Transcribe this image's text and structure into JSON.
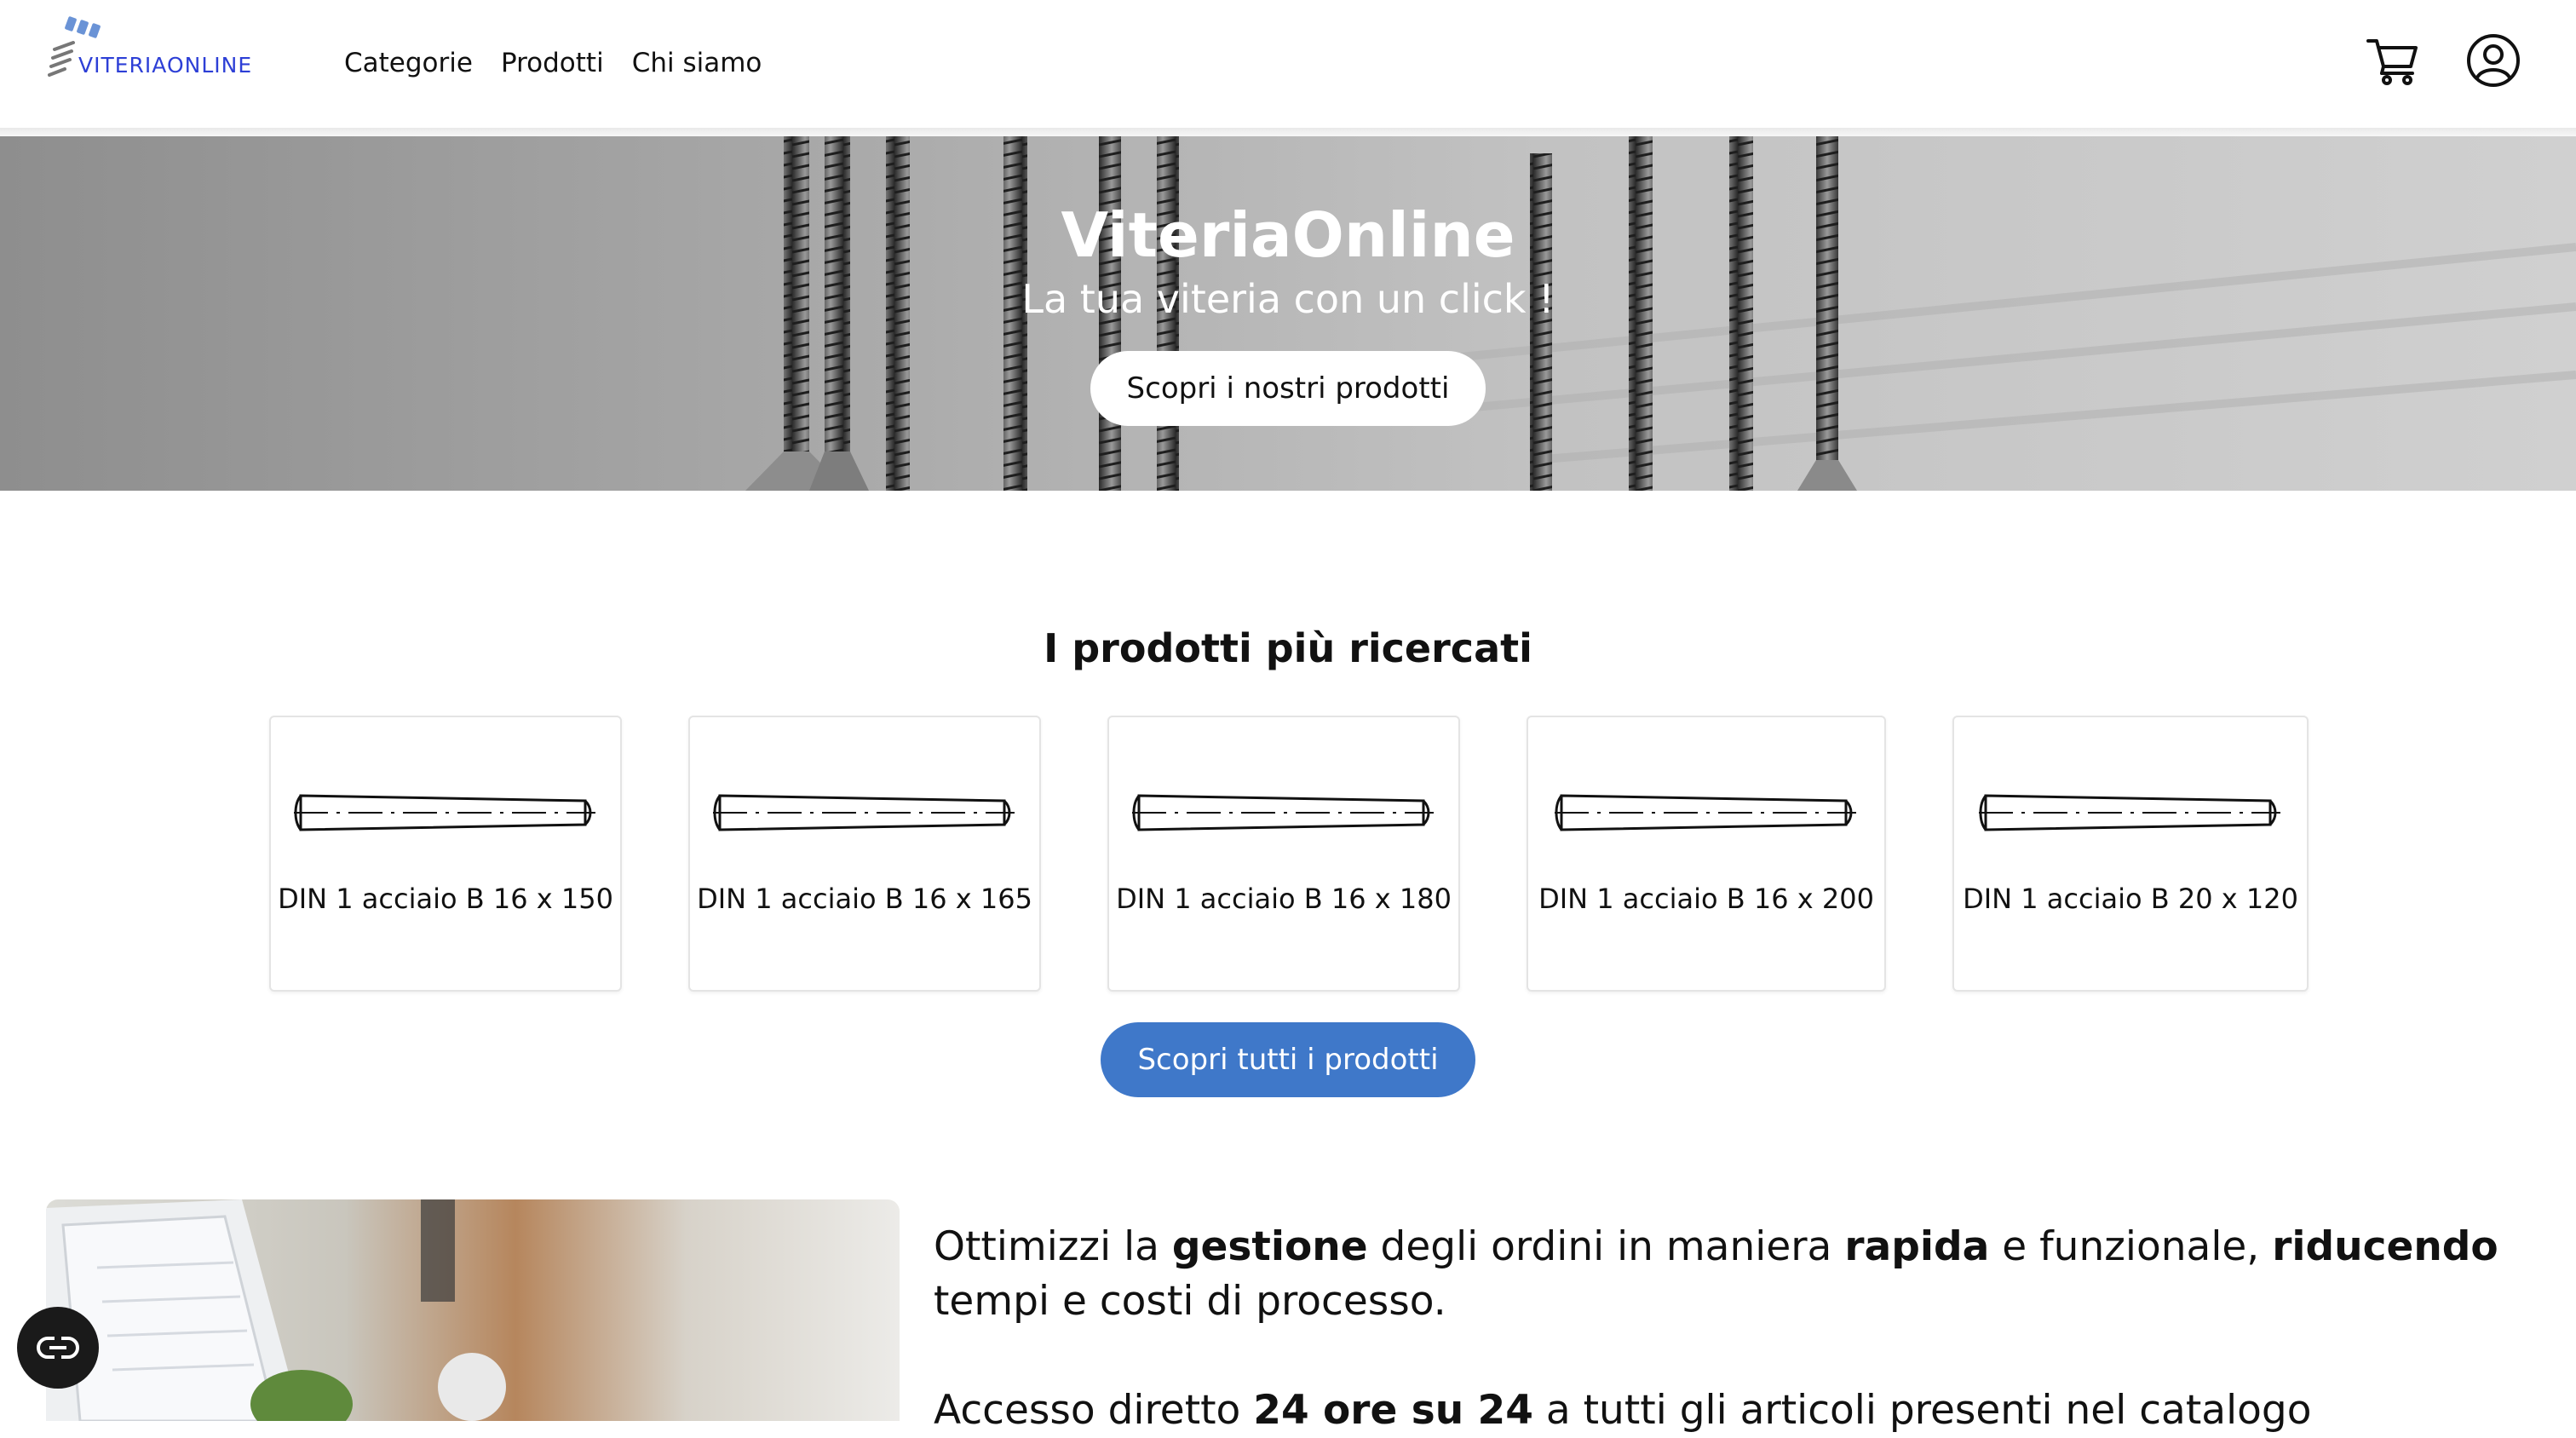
{
  "header": {
    "logo_text": "VITERIAONLINE",
    "nav": [
      "Categorie",
      "Prodotti",
      "Chi siamo"
    ],
    "cart_icon": "cart-icon",
    "user_icon": "user-circle-icon"
  },
  "hero": {
    "title": "ViteriaOnline",
    "subtitle": "La tua viteria con un click !",
    "cta": "Scopri i nostri prodotti"
  },
  "products": {
    "title": "I prodotti più ricercati",
    "items": [
      {
        "name": "DIN 1 acciaio B 16 x 150"
      },
      {
        "name": "DIN 1 acciaio B 16 x 165"
      },
      {
        "name": "DIN 1 acciaio B 16 x 180"
      },
      {
        "name": "DIN 1 acciaio B 16 x 200"
      },
      {
        "name": "DIN 1 acciaio B 20 x 120"
      }
    ],
    "cta": "Scopri tutti i prodotti"
  },
  "info": {
    "p1": [
      "Ottimizzi la ",
      "gestione",
      " degli ordini in maniera ",
      "rapida",
      " e funzionale, ",
      "riducendo",
      " tempi e costi di processo."
    ],
    "p2": [
      "Accesso diretto ",
      "24 ore su 24",
      " a tutti gli articoli presenti nel catalogo"
    ]
  },
  "colors": {
    "accent_button": "#3f78c9",
    "logo_blue": "#2d3fd6",
    "logo_icon": "#6a93d6"
  },
  "accessibility": {
    "icon": "accessibility-icon"
  }
}
